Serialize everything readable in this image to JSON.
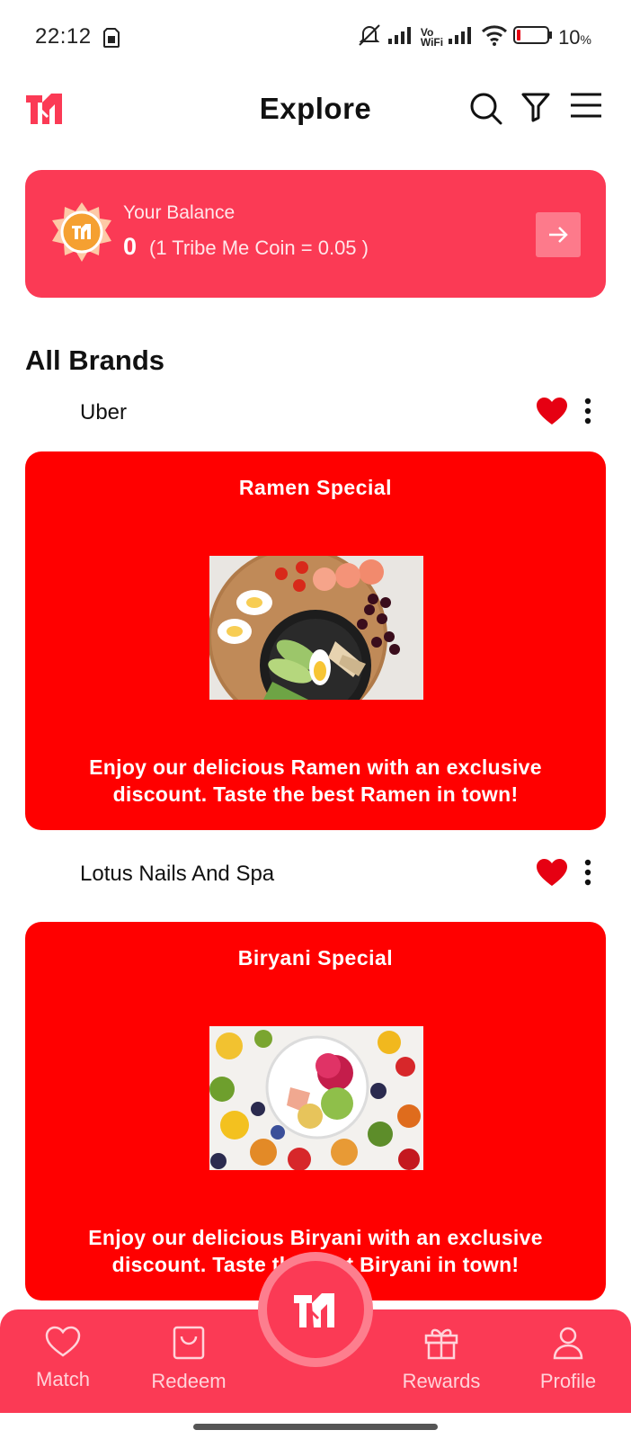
{
  "status_bar": {
    "time": "22:12",
    "battery_percent": "10",
    "battery_unit": "%"
  },
  "header": {
    "title": "Explore",
    "icons": [
      "search-icon",
      "filter-icon",
      "menu-icon"
    ]
  },
  "balance": {
    "label": "Your Balance",
    "amount": "0",
    "rate": "(1 Tribe Me Coin = 0.05 )"
  },
  "section_title": "All Brands",
  "brands": [
    {
      "name": "Uber",
      "offer_title": "Ramen Special",
      "offer_description": "Enjoy our delicious Ramen with an exclusive discount. Taste the best Ramen in town!",
      "favorited": true
    },
    {
      "name": "Lotus Nails And Spa",
      "offer_title": "Biryani Special",
      "offer_description": "Enjoy our delicious Biryani with an exclusive discount. Taste the best Biryani in town!",
      "favorited": true
    }
  ],
  "bottom_nav": {
    "items": [
      {
        "label": "Match",
        "icon": "heart-outline-icon"
      },
      {
        "label": "Redeem",
        "icon": "bag-icon"
      },
      {
        "label": "Rewards",
        "icon": "gift-icon"
      },
      {
        "label": "Profile",
        "icon": "user-icon"
      }
    ]
  },
  "colors": {
    "brand_pink": "#fb3a55",
    "offer_red": "#ff0000",
    "heart_red": "#e60012"
  }
}
